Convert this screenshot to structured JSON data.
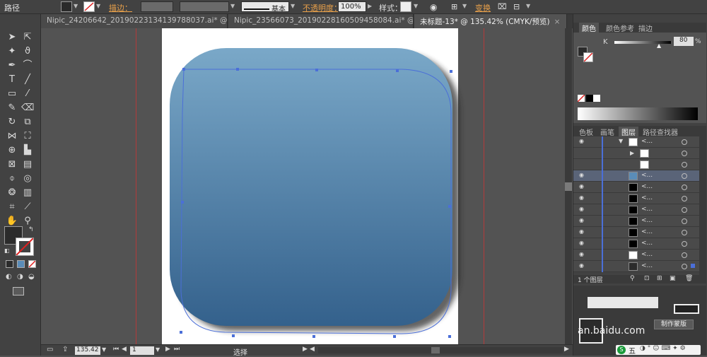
{
  "control_bar": {
    "object_type": "路径",
    "stroke_label": "描边：",
    "stroke_profile": "基本",
    "opacity_label": "不透明度：",
    "opacity_value": "100%",
    "style_label": "样式：",
    "transform_label": "变换"
  },
  "doc_tabs": [
    {
      "label": "Nipic_24206642_20190223134139788037.ai* @ 50...",
      "close": "×"
    },
    {
      "label": "Nipic_23566073_20190228160509458084.ai* @ 98...",
      "close": "×"
    },
    {
      "label": "未标题-13* @ 135.42% (CMYK/预览)",
      "close": "×",
      "active": true
    }
  ],
  "status_bar": {
    "zoom": "135.42",
    "page": "1",
    "tool_status": "选择"
  },
  "color_panel": {
    "tabs": [
      "颜色",
      "颜色参考",
      "描边"
    ],
    "channel_label": "K",
    "channel_value": "80",
    "percent": "%"
  },
  "layers_panel": {
    "tabs": [
      "色板",
      "画笔",
      "图层",
      "路径查找器"
    ],
    "footer_text": "1 个图层",
    "row_glyph": "<..."
  },
  "lower_panel": {
    "mask_button": "制作蒙版",
    "watermark": "an.baidu.com",
    "ime_text": "五"
  },
  "shape": {
    "gradient_top": "#7aa8c8",
    "gradient_bottom": "#34618c",
    "selection_color": "#4b6fd8"
  }
}
